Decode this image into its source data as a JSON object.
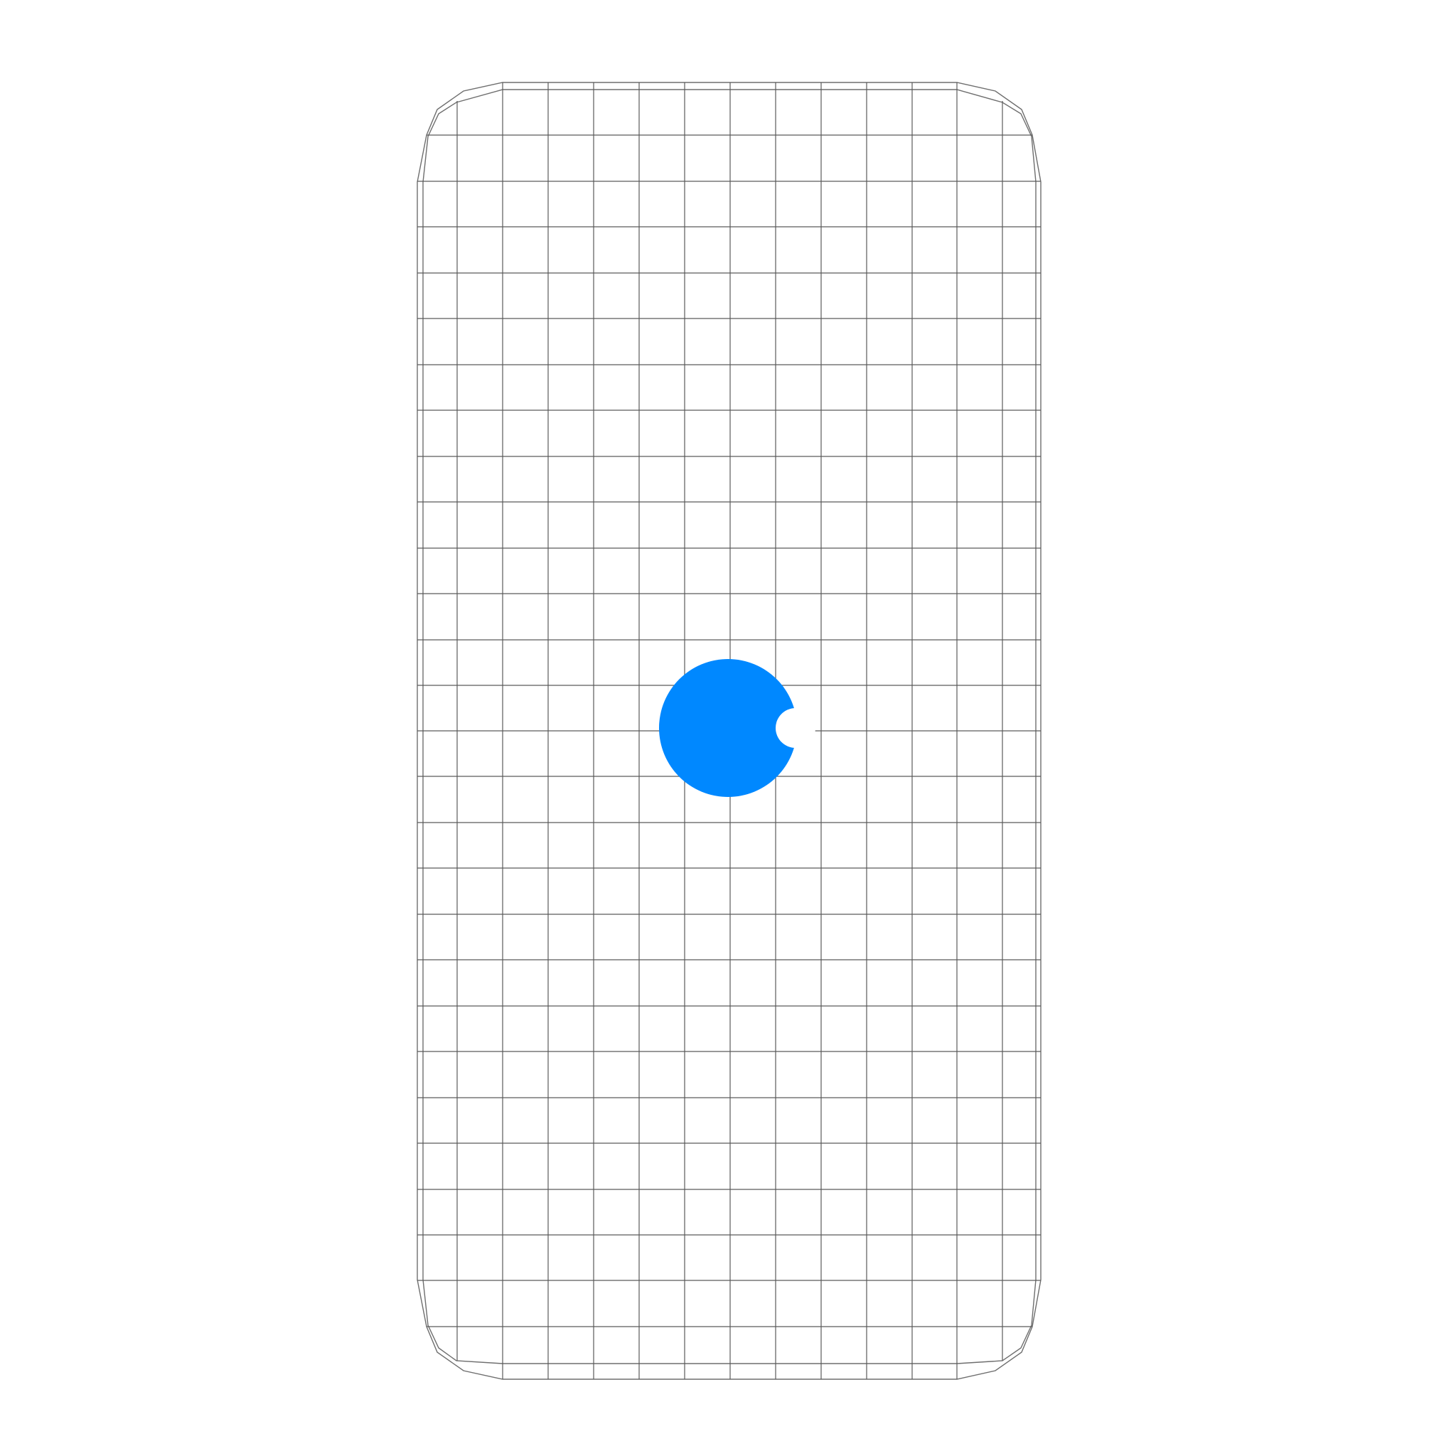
{
  "screen": {
    "background_color": "#ffffff",
    "grid_color": "#5a5a5a",
    "outline_color": "#6e6e6e"
  },
  "cursor": {
    "icon": "blue-dot-cursor-icon",
    "color": "#0088ff"
  }
}
